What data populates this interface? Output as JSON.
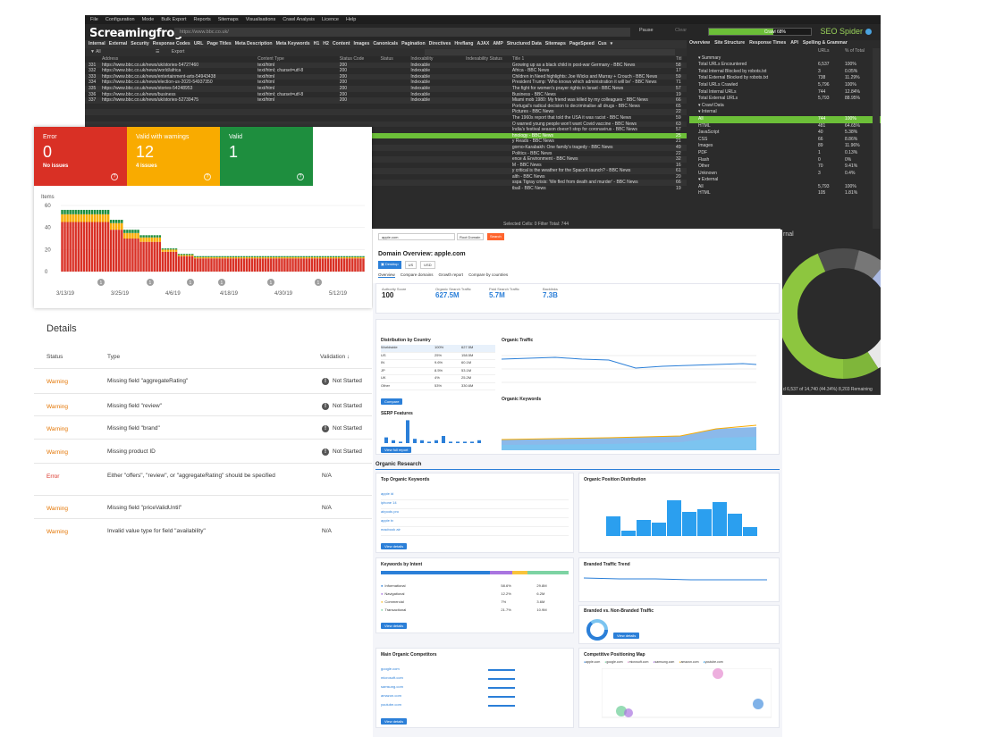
{
  "sf": {
    "menu": [
      "File",
      "Configuration",
      "Mode",
      "Bulk Export",
      "Reports",
      "Sitemaps",
      "Visualisations",
      "Crawl Analysis",
      "Licence",
      "Help"
    ],
    "logo": "Screamingfrog",
    "url": "https://www.bbc.co.uk/",
    "pause": "Pause",
    "clear": "Clear",
    "progress_pct": 0.63,
    "progress_label": "Crawl 68%",
    "brand": "SEO Spider",
    "tabs": [
      "Internal",
      "External",
      "Security",
      "Response Codes",
      "URL",
      "Page Titles",
      "Meta Description",
      "Meta Keywords",
      "H1",
      "H2",
      "Content",
      "Images",
      "Canonicals",
      "Pagination",
      "Directives",
      "Hreflang",
      "AJAX",
      "AMP",
      "Structured Data",
      "Sitemaps",
      "PageSpeed",
      "Cus"
    ],
    "right_tabs": [
      "Overview",
      "Site Structure",
      "Response Times",
      "API",
      "Spelling & Grammar"
    ],
    "filter_label": "All",
    "export_label": "Export",
    "columns": [
      "",
      "Address",
      "Content Type",
      "Status Code",
      "Status",
      "Indexability",
      "Indexability Status",
      "Title 1",
      "Titl"
    ],
    "rows": [
      [
        "331",
        "https://www.bbc.co.uk/news/uk/stories-54727460",
        "text/html",
        "200",
        "",
        "Indexable",
        "",
        "Growing up as a black child in post-war Germany - BBC News",
        "58"
      ],
      [
        "332",
        "https://www.bbc.co.uk/news/world/africa",
        "text/html; charset=utf-8",
        "200",
        "",
        "Indexable",
        "",
        "Africa - BBC News",
        "17"
      ],
      [
        "333",
        "https://www.bbc.co.uk/news/entertainment-arts-54943438",
        "text/html",
        "200",
        "",
        "Indexable",
        "",
        "Children in Need highlights: Joe Wicks and Murray + Crouch - BBC News",
        "59"
      ],
      [
        "334",
        "https://www.bbc.co.uk/news/election-us-2020-54937350",
        "text/html",
        "200",
        "",
        "Indexable",
        "",
        "President Trump: 'Who knows which administration it will be' - BBC News",
        "71"
      ],
      [
        "335",
        "https://www.bbc.co.uk/news/stories-54248953",
        "text/html",
        "200",
        "",
        "Indexable",
        "",
        "The fight for women's prayer rights in Israel - BBC News",
        "57"
      ],
      [
        "336",
        "https://www.bbc.co.uk/news/business",
        "text/html; charset=utf-8",
        "200",
        "",
        "Indexable",
        "",
        "Business - BBC News",
        "19"
      ],
      [
        "337",
        "https://www.bbc.co.uk/news/uk/stories-52739475",
        "text/html",
        "200",
        "",
        "Indexable",
        "",
        "Miami mob 1980: My friend was killed by my colleagues - BBC News",
        "66"
      ],
      [
        "",
        "",
        "",
        "",
        "",
        "",
        "",
        "Portugal's radical decision to decriminalise all drugs - BBC News",
        "65"
      ],
      [
        "",
        "",
        "",
        "",
        "",
        "",
        "",
        "Pictures - BBC News",
        "22"
      ],
      [
        "",
        "",
        "",
        "",
        "",
        "",
        "",
        "The 1960s report that told the USA it was racist - BBC News",
        "59"
      ],
      [
        "",
        "",
        "",
        "",
        "",
        "",
        "",
        "O warned young people won't want Covid vaccine - BBC News",
        "63"
      ],
      [
        "",
        "",
        "",
        "",
        "",
        "",
        "",
        "India's festival season doesn't stop for coronavirus - BBC News",
        "57"
      ],
      [
        "",
        "",
        "",
        "",
        "",
        "",
        "",
        "hnology - BBC News",
        "25"
      ],
      [
        "",
        "",
        "",
        "",
        "",
        "",
        "",
        "y Reads - BBC News",
        "21"
      ],
      [
        "",
        "",
        "",
        "",
        "",
        "",
        "",
        "gorno-Karabakh: One family's tragedy - BBC News",
        "49"
      ],
      [
        "",
        "",
        "",
        "",
        "",
        "",
        "",
        "Politics - BBC News",
        "22"
      ],
      [
        "",
        "",
        "",
        "",
        "",
        "",
        "",
        "ence & Environment - BBC News",
        "32"
      ],
      [
        "",
        "",
        "",
        "",
        "",
        "",
        "",
        "M - BBC News",
        "16"
      ],
      [
        "",
        "",
        "",
        "",
        "",
        "",
        "",
        "y critical is the weather for the SpaceX launch? - BBC News",
        "61"
      ],
      [
        "",
        "",
        "",
        "",
        "",
        "",
        "",
        "alth - BBC News",
        "20"
      ],
      [
        "",
        "",
        "",
        "",
        "",
        "",
        "",
        "sspa Tigray crisis: 'We fled from death and murder' - BBC News",
        "66"
      ],
      [
        "",
        "",
        "",
        "",
        "",
        "",
        "",
        "tball - BBC News",
        "19"
      ]
    ],
    "selected_row": 12,
    "status_bar": "Selected Cells: 0  Filter Total: 744",
    "right_columns": [
      "",
      "URLs",
      "% of Total"
    ],
    "summary": [
      {
        "label": "Summary",
        "level": "sec",
        "v": "",
        "p": ""
      },
      {
        "label": "Total URLs Encountered",
        "level": "leaf",
        "v": "6,537",
        "p": "100%"
      },
      {
        "label": "Total Internal Blocked by robots.txt",
        "level": "leaf",
        "v": "3",
        "p": "0.05%"
      },
      {
        "label": "Total External Blocked by robots.txt",
        "level": "leaf",
        "v": "738",
        "p": "11.29%"
      },
      {
        "label": "Total URLs Crawled",
        "level": "leaf",
        "v": "5,796",
        "p": "100%"
      },
      {
        "label": "Total Internal URLs",
        "level": "leaf",
        "v": "744",
        "p": "12.84%"
      },
      {
        "label": "Total External URLs",
        "level": "leaf",
        "v": "5,793",
        "p": "88.95%"
      },
      {
        "label": "Crawl Data",
        "level": "sec",
        "v": "",
        "p": ""
      },
      {
        "label": "Internal",
        "level": "sub",
        "v": "",
        "p": ""
      },
      {
        "label": "All",
        "level": "leaf",
        "v": "744",
        "p": "100%"
      },
      {
        "label": "HTML",
        "level": "leaf",
        "v": "481",
        "p": "64.65%"
      },
      {
        "label": "JavaScript",
        "level": "leaf",
        "v": "40",
        "p": "5.38%"
      },
      {
        "label": "CSS",
        "level": "leaf",
        "v": "66",
        "p": "8.86%"
      },
      {
        "label": "Images",
        "level": "leaf",
        "v": "89",
        "p": "11.96%"
      },
      {
        "label": "PDF",
        "level": "leaf",
        "v": "1",
        "p": "0.13%"
      },
      {
        "label": "Flash",
        "level": "leaf",
        "v": "0",
        "p": "0%"
      },
      {
        "label": "Other",
        "level": "leaf",
        "v": "70",
        "p": "9.41%"
      },
      {
        "label": "Unknown",
        "level": "leaf",
        "v": "3",
        "p": "0.4%"
      },
      {
        "label": "External",
        "level": "sub",
        "v": "",
        "p": ""
      },
      {
        "label": "All",
        "level": "leaf",
        "v": "5,793",
        "p": "100%"
      },
      {
        "label": "HTML",
        "level": "leaf",
        "v": "105",
        "p": "1.81%"
      }
    ],
    "highlight_summary": 9,
    "donut_label": "rnal",
    "donut_caption": "d 6,537 of 14,740 (44.34%) 8,203 Remaining",
    "donut_colors": [
      "#8dc63f",
      "#5a5a5a",
      "#9fb5e0",
      "#cfcfcf",
      "#ffffff"
    ]
  },
  "gsc": {
    "tiles": [
      {
        "title": "Error",
        "count": "0",
        "sub": "No issues",
        "color": "#d93025"
      },
      {
        "title": "Valid with warnings",
        "count": "12",
        "sub": "4 issues",
        "color": "#f9ab00"
      },
      {
        "title": "Valid",
        "count": "1",
        "sub": "",
        "color": "#1e8e3e"
      }
    ],
    "chart_data": {
      "type": "bar",
      "title": "",
      "ylabel": "Items",
      "ylim": [
        0,
        60
      ],
      "yticks": [
        "60",
        "40",
        "20",
        "0"
      ],
      "xticks": [
        "3/13/19",
        "3/25/19",
        "4/6/19",
        "4/18/19",
        "4/30/19",
        "5/12/19"
      ],
      "series": [
        {
          "name": "Error",
          "color": "#d93025"
        },
        {
          "name": "Valid with warnings",
          "color": "#f9ab00"
        },
        {
          "name": "Valid",
          "color": "#1e8e3e"
        }
      ],
      "error": [
        45,
        45,
        45,
        45,
        45,
        45,
        45,
        45,
        45,
        45,
        45,
        45,
        45,
        45,
        45,
        45,
        45,
        45,
        38,
        38,
        38,
        38,
        38,
        30,
        30,
        30,
        30,
        30,
        30,
        27,
        27,
        27,
        27,
        27,
        27,
        27,
        27,
        18,
        18,
        18,
        18,
        18,
        18,
        14,
        14,
        14,
        14,
        14,
        14,
        12,
        12,
        12,
        12,
        12,
        12,
        12,
        12,
        12,
        12,
        12,
        12,
        12,
        12,
        12,
        12,
        12,
        12,
        12,
        12,
        12,
        12,
        12,
        12,
        12,
        12,
        12,
        12,
        12,
        12,
        12,
        12,
        12,
        12,
        12,
        12,
        12,
        12,
        12,
        12,
        12,
        12,
        12,
        12,
        12,
        12,
        12,
        12,
        12,
        12,
        12,
        12,
        12,
        12,
        12,
        12,
        12,
        12,
        12,
        12,
        12,
        12,
        12
      ],
      "warning": [
        7,
        7,
        7,
        7,
        7,
        7,
        7,
        7,
        7,
        7,
        7,
        7,
        7,
        7,
        7,
        7,
        7,
        7,
        6,
        6,
        6,
        6,
        6,
        5,
        5,
        5,
        5,
        5,
        5,
        4,
        4,
        4,
        4,
        4,
        4,
        4,
        4,
        2,
        2,
        2,
        2,
        2,
        2,
        1,
        1,
        1,
        1,
        1,
        1,
        1,
        1,
        1,
        1,
        1,
        1,
        1,
        1,
        1,
        1,
        1,
        1,
        1,
        1,
        1,
        1,
        1,
        1,
        1,
        1,
        1,
        1,
        1,
        1,
        1,
        1,
        1,
        1,
        1,
        1,
        1,
        1,
        1,
        1,
        1,
        1,
        1,
        1,
        1,
        1,
        1,
        1,
        1,
        1,
        1,
        1,
        1,
        1,
        1,
        1,
        1,
        1,
        1,
        1,
        1,
        1,
        1,
        1,
        1,
        1,
        1,
        1,
        1
      ],
      "valid": [
        4,
        4,
        4,
        4,
        4,
        4,
        4,
        4,
        4,
        4,
        4,
        4,
        4,
        4,
        4,
        4,
        4,
        4,
        3,
        3,
        3,
        3,
        3,
        3,
        3,
        3,
        3,
        3,
        3,
        2,
        2,
        2,
        2,
        2,
        2,
        2,
        2,
        1,
        1,
        1,
        1,
        1,
        1,
        1,
        1,
        1,
        1,
        1,
        1,
        1,
        1,
        1,
        1,
        1,
        1,
        1,
        1,
        1,
        1,
        1,
        1,
        1,
        1,
        1,
        1,
        1,
        1,
        1,
        1,
        1,
        1,
        1,
        1,
        1,
        1,
        1,
        1,
        1,
        1,
        1,
        1,
        1,
        1,
        1,
        1,
        1,
        1,
        1,
        1,
        1,
        1,
        1,
        1,
        1,
        1,
        1,
        1,
        1,
        1,
        1,
        1,
        1,
        1,
        1,
        1,
        1,
        1,
        1,
        1,
        1,
        1,
        1
      ]
    },
    "markers": [
      "1",
      "1",
      "1",
      "1",
      "1",
      "1"
    ]
  },
  "details": {
    "title": "Details",
    "headers": {
      "status": "Status",
      "type": "Type",
      "validation": "Validation"
    },
    "rows": [
      {
        "status": "Warning",
        "type": "Missing field \"aggregateRating\"",
        "validation": "Not Started",
        "error": false
      },
      {
        "status": "Warning",
        "type": "Missing field \"review\"",
        "validation": "Not Started",
        "error": false
      },
      {
        "status": "Warning",
        "type": "Missing field \"brand\"",
        "validation": "Not Started",
        "error": false
      },
      {
        "status": "Warning",
        "type": "Missing product ID",
        "validation": "Not Started",
        "error": false
      },
      {
        "status": "Error",
        "type": "Either \"offers\", \"review\", or \"aggregateRating\" should be specified",
        "validation": "N/A",
        "error": true
      },
      {
        "status": "Warning",
        "type": "Missing field \"priceValidUntil\"",
        "validation": "N/A",
        "error": false
      },
      {
        "status": "Warning",
        "type": "Invalid value type for field \"availability\"",
        "validation": "N/A",
        "error": false
      }
    ]
  },
  "sem": {
    "title": "Domain Overview: apple.com",
    "search": "apple.com",
    "search_btn": "Search",
    "root_domain": "Root Domain",
    "tabs": [
      "Overview",
      "Compare domains",
      "Growth report",
      "Compare by countries"
    ],
    "metrics": [
      {
        "label": "Authority Score",
        "value": "100"
      },
      {
        "label": "Organic Search Traffic",
        "value": "627.5M"
      },
      {
        "label": "Paid Search Traffic",
        "value": "5.7M"
      },
      {
        "label": "Backlinks",
        "value": "7.3B"
      }
    ],
    "sections": {
      "dist": "Distribution by Country",
      "traffic": "Organic Traffic",
      "serp": "SERP Features",
      "organic_kw": "Organic Keywords",
      "research": "Organic Research",
      "top_kw": "Top Organic Keywords",
      "position": "Organic Position Distribution",
      "intent": "Keywords by Intent",
      "branded_trend": "Branded Traffic Trend",
      "branded_vs": "Branded vs. Non-Branded Traffic",
      "competitors": "Main Organic Competitors",
      "map": "Competitive Positioning Map"
    },
    "countries": [
      {
        "name": "Worldwide",
        "share": "100%",
        "traffic": "627.5M"
      },
      {
        "name": "US",
        "share": "25%",
        "traffic": "158.5M"
      },
      {
        "name": "IN",
        "share": "9.6%",
        "traffic": "60.1M"
      },
      {
        "name": "JP",
        "share": "8.5%",
        "traffic": "53.1M"
      },
      {
        "name": "UK",
        "share": "4%",
        "traffic": "25.2M"
      },
      {
        "name": "Other",
        "share": "53%",
        "traffic": "330.6M"
      }
    ],
    "compare_btn": "Compare",
    "view_btn": "View details",
    "full_report": "View full report",
    "keywords": [
      "apple id",
      "iphone 14",
      "airpods pro",
      "apple tv",
      "macbook air"
    ],
    "intents": [
      {
        "name": "Informational",
        "pct": "58.6%",
        "kw": "29.8M"
      },
      {
        "name": "Navigational",
        "pct": "12.2%",
        "kw": "6.2M"
      },
      {
        "name": "Commercial",
        "pct": "7%",
        "kw": "3.6M"
      },
      {
        "name": "Transactional",
        "pct": "21.7%",
        "kw": "10.9M"
      }
    ],
    "competitors": [
      "google.com",
      "microsoft.com",
      "samsung.com",
      "amazon.com",
      "youtube.com"
    ],
    "map_legend": [
      "apple.com",
      "google.com",
      "microsoft.com",
      "samsung.com",
      "amazon.com",
      "youtube.com"
    ]
  }
}
